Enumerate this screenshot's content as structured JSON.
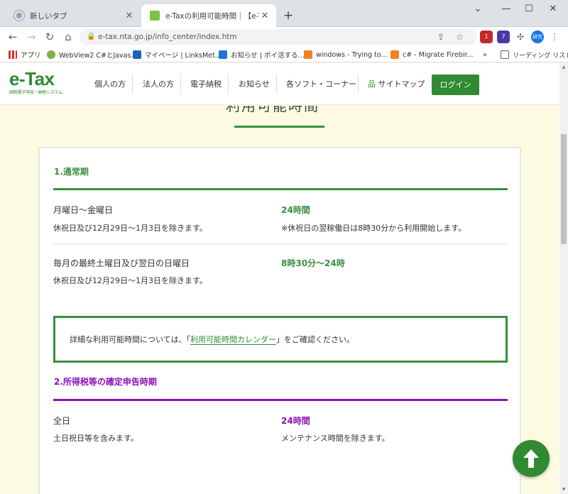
{
  "browser": {
    "tabs": [
      {
        "title": "新しいタブ"
      },
      {
        "title": "e-Taxの利用可能時間｜【e-Tax】国税電子..."
      }
    ],
    "url": "e-tax.nta.go.jp/info_center/index.htm",
    "profile_label": "研究",
    "ext_badges": [
      "1",
      "7"
    ],
    "bookmarks": [
      {
        "label": "アプリ",
        "icon": "apps-icon"
      },
      {
        "label": "WebView2 C#とJavas...",
        "icon": "webview-icon"
      },
      {
        "label": "マイページ | LinksMet...",
        "icon": "links-icon"
      },
      {
        "label": "お知らせ | ポイ活する...",
        "icon": "bookmark-icon"
      },
      {
        "label": "windows - Trying to...",
        "icon": "stackoverflow-icon"
      },
      {
        "label": "c# - Migrate Firebir...",
        "icon": "stackoverflow-icon"
      }
    ],
    "reading_list": "リーディング リスト"
  },
  "site": {
    "logo_main": "e-Tax",
    "logo_sub": "国税電子申告・納税システム",
    "nav": [
      "個人の方",
      "法人の方",
      "電子納税",
      "お知らせ",
      "各ソフト・コーナー"
    ],
    "sitemap": "サイトマップ",
    "login": "ログイン"
  },
  "page": {
    "heading": "利用可能時間",
    "sections": [
      {
        "title": "1.通常期",
        "color": "#3a8f3e",
        "rows": [
          {
            "label": "月曜日～金曜日",
            "note": "休祝日及び12月29日～1月3日を除きます。",
            "value": "24時間",
            "value_note": "※休祝日の翌稼働日は8時30分から利用開始します。"
          },
          {
            "label": "毎月の最終土曜日及び翌日の日曜日",
            "note": "休祝日及び12月29日～1月3日を除きます。",
            "value": "8時30分～24時",
            "value_note": ""
          }
        ]
      },
      {
        "title": "2.所得税等の確定申告時期",
        "color": "#8a12b8",
        "rows": [
          {
            "label": "全日",
            "note": "土日祝日等を含みます。",
            "value": "24時間",
            "value_note": "メンテナンス時間を除きます。"
          }
        ]
      }
    ],
    "notice_prefix": "詳細な利用可能時間については、「",
    "notice_link": "利用可能時間カレンダー",
    "notice_suffix": "」をご確認ください。"
  }
}
